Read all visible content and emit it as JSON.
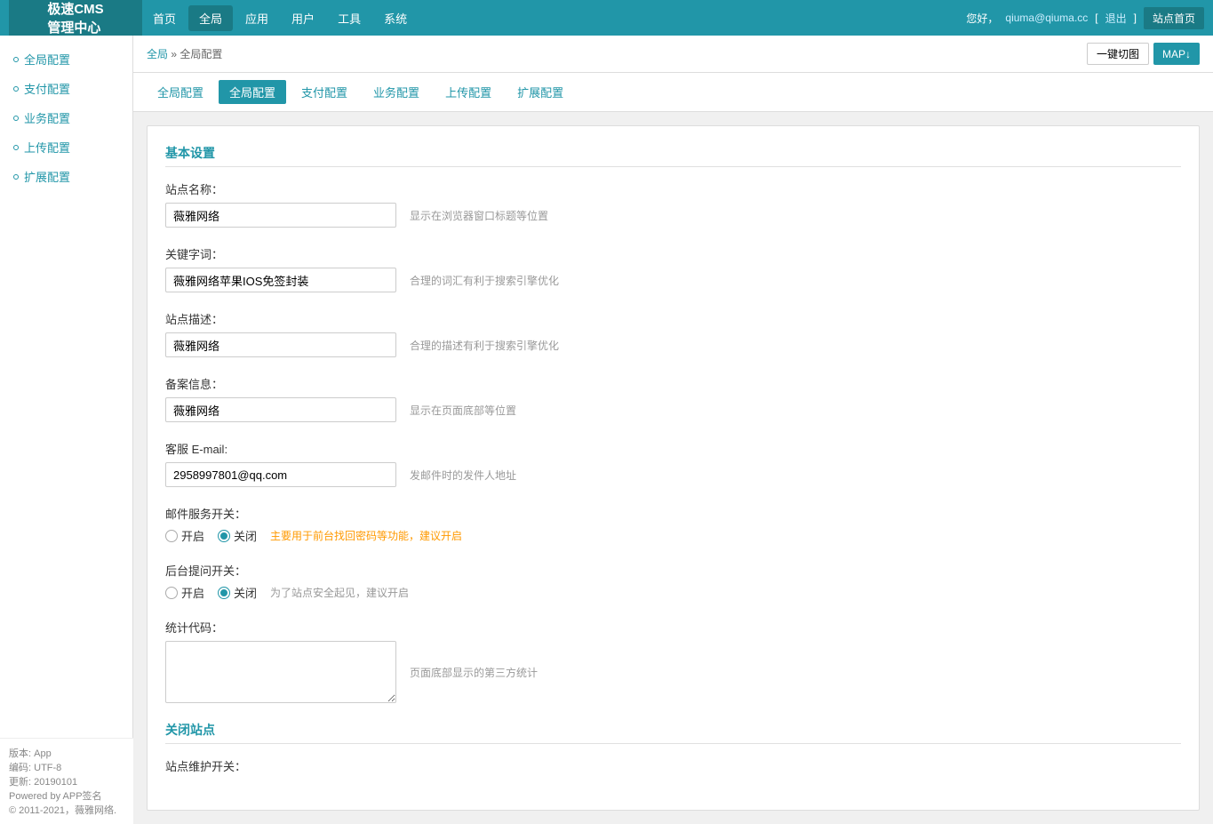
{
  "logo": {
    "line1": "极速CMS",
    "line2": "管理中心"
  },
  "topnav": {
    "links": [
      "首页",
      "全局",
      "应用",
      "用户",
      "工具",
      "系统"
    ],
    "active": "全局",
    "user": "qiuma@qiuma.cc",
    "logout_label": "退出",
    "site_btn": "站点首页",
    "greeting": "您好，"
  },
  "breadcrumb": {
    "root": "全局",
    "current": "全局配置",
    "btn_switch": "一键切图",
    "btn_map": "MAP↓"
  },
  "sidebar": {
    "items": [
      {
        "label": "全局配置"
      },
      {
        "label": "支付配置"
      },
      {
        "label": "业务配置"
      },
      {
        "label": "上传配置"
      },
      {
        "label": "扩展配置"
      }
    ]
  },
  "subtabs": {
    "items": [
      "全局配置",
      "全局配置",
      "支付配置",
      "业务配置",
      "上传配置",
      "扩展配置"
    ],
    "active_index": 1
  },
  "sections": {
    "basic": {
      "title": "基本设置",
      "fields": [
        {
          "label": "站点名称：",
          "value": "薇雅网络",
          "hint": "显示在浏览器窗口标题等位置"
        },
        {
          "label": "关键字词：",
          "value": "薇雅网络苹果IOS免签封装",
          "hint": "合理的词汇有利于搜索引擎优化"
        },
        {
          "label": "站点描述：",
          "value": "薇雅网络",
          "hint": "合理的描述有利于搜索引擎优化"
        },
        {
          "label": "备案信息：",
          "value": "薇雅网络",
          "hint": "显示在页面底部等位置"
        },
        {
          "label": "客服 E-mail:",
          "value": "2958997801@qq.com",
          "hint": "发邮件时的发件人地址"
        }
      ],
      "mail_service": {
        "label": "邮件服务开关：",
        "options": [
          "开启",
          "关闭"
        ],
        "selected": 1,
        "hint": "主要用于前台找回密码等功能，建议开启"
      },
      "backend_tip": {
        "label": "后台提问开关：",
        "options": [
          "开启",
          "关闭"
        ],
        "selected": 1,
        "hint": "为了站点安全起见，建议开启"
      },
      "stats_code": {
        "label": "统计代码：",
        "value": "",
        "hint": "页面底部显示的第三方统计"
      }
    },
    "close_site": {
      "title": "关闭站点",
      "maintenance_label": "站点维护开关："
    }
  },
  "footer": {
    "version_label": "版本:",
    "version": "App",
    "encoding_label": "编码:",
    "encoding": "UTF-8",
    "updated_label": "更新:",
    "updated": "20190101",
    "powered": "Powered by APP签名",
    "copyright": "© 2011-2021，薇雅网络."
  }
}
